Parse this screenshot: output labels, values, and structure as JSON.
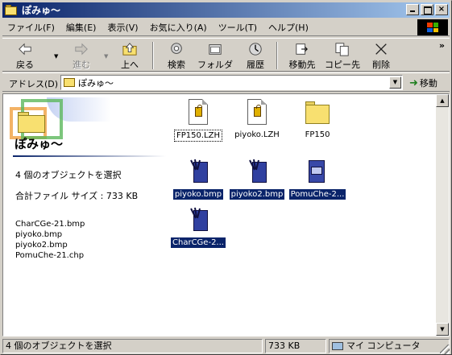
{
  "window": {
    "title": "ぽみゅ〜",
    "controls": {
      "minimize": "_",
      "maximize": "□",
      "close": "×"
    }
  },
  "menu": [
    "ファイル(F)",
    "編集(E)",
    "表示(V)",
    "お気に入り(A)",
    "ツール(T)",
    "ヘルプ(H)"
  ],
  "toolbar": {
    "back": "戻る",
    "forward": "進む",
    "up": "上へ",
    "search": "検索",
    "folders": "フォルダ",
    "history": "履歴",
    "move_to": "移動先",
    "copy_to": "コピー先",
    "delete": "削除",
    "more": "»"
  },
  "address": {
    "label": "アドレス(D)",
    "value": "ぽみゅ〜",
    "go": "移動"
  },
  "sidebar": {
    "folder_title": "ぽみゅ〜",
    "selected_count": "4 個のオブジェクトを選択",
    "total_size": "合計ファイル サイズ : 733 KB",
    "selected_files": [
      "CharCGe-21.bmp",
      "piyoko.bmp",
      "piyoko2.bmp",
      "PomuChe-21.chp"
    ]
  },
  "files": [
    {
      "name": "FP150.LZH",
      "type": "lzh-icon",
      "selected": false,
      "focused": true
    },
    {
      "name": "piyoko.LZH",
      "type": "lzh-icon",
      "selected": false,
      "focused": false
    },
    {
      "name": "FP150",
      "type": "folder-icon",
      "selected": false,
      "focused": false
    },
    {
      "name": "piyoko.bmp",
      "type": "bmp-icon",
      "selected": true,
      "focused": false
    },
    {
      "name": "piyoko2.bmp",
      "type": "bmp-icon",
      "selected": true,
      "focused": false
    },
    {
      "name": "PomuChe-2...",
      "type": "chp-icon",
      "selected": true,
      "focused": false
    },
    {
      "name": "CharCGe-2...",
      "type": "bmp-icon",
      "selected": true,
      "focused": false
    }
  ],
  "status": {
    "selection": "4 個のオブジェクトを選択",
    "size": "733 KB",
    "zone": "マイ コンピュータ"
  },
  "colors": {
    "titlebar_start": "#0a246a",
    "titlebar_end": "#a6caf0",
    "selection": "#0a246a",
    "face": "#d4d0c8"
  }
}
